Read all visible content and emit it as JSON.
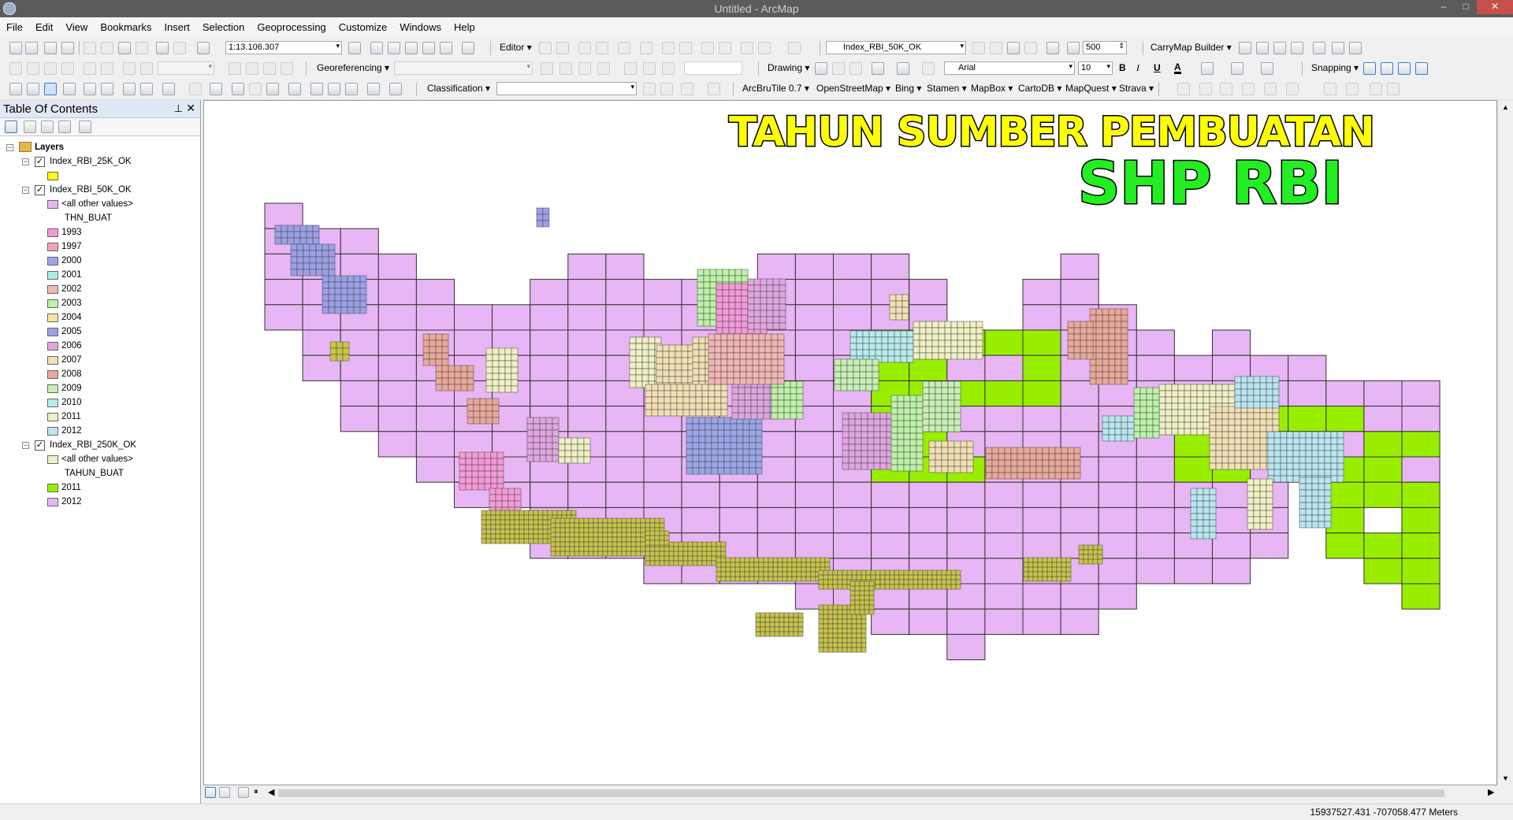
{
  "window": {
    "title": "Untitled - ArcMap",
    "minimize": "–",
    "maximize": "□",
    "close": "✕"
  },
  "menu": [
    "File",
    "Edit",
    "View",
    "Bookmarks",
    "Insert",
    "Selection",
    "Geoprocessing",
    "Customize",
    "Windows",
    "Help"
  ],
  "toolbar": {
    "scale": "1:13.106.307",
    "editor": "Editor",
    "target_layer": "Index_RBI_50K_OK",
    "zoom_value": "500",
    "carrymap": "CarryMap Builder",
    "georeferencing": "Georeferencing",
    "drawing": "Drawing",
    "font": "Arial",
    "font_size": "10",
    "bold": "B",
    "italic": "I",
    "underline": "U",
    "font_color": "A",
    "snapping": "Snapping",
    "classification": "Classification",
    "basemaps": [
      "ArcBruTile 0.7",
      "OpenStreetMap",
      "Bing",
      "Stamen",
      "MapBox",
      "CartoDB",
      "MapQuest",
      "Strava"
    ]
  },
  "toc": {
    "title": "Table Of Contents",
    "root": "Layers",
    "layer_25k": {
      "name": "Index_RBI_25K_OK",
      "color": "#ffff00"
    },
    "layer_50k": {
      "name": "Index_RBI_50K_OK",
      "other": "<all other values>",
      "field": "THN_BUAT",
      "classes": [
        {
          "label": "1993",
          "color": "#f49ad8"
        },
        {
          "label": "1997",
          "color": "#f4a6b6"
        },
        {
          "label": "2000",
          "color": "#9aa6e8"
        },
        {
          "label": "2001",
          "color": "#a6eee6"
        },
        {
          "label": "2002",
          "color": "#f2b6b6"
        },
        {
          "label": "2003",
          "color": "#bdf2a8"
        },
        {
          "label": "2004",
          "color": "#f6e89a"
        },
        {
          "label": "2005",
          "color": "#9ca0e8"
        },
        {
          "label": "2006",
          "color": "#e0a6e0"
        },
        {
          "label": "2007",
          "color": "#f2e0b4"
        },
        {
          "label": "2008",
          "color": "#eaa89a"
        },
        {
          "label": "2009",
          "color": "#c6f0b4"
        },
        {
          "label": "2010",
          "color": "#b6ecec"
        },
        {
          "label": "2011",
          "color": "#f0f0c4"
        },
        {
          "label": "2012",
          "color": "#b8e6f0"
        }
      ]
    },
    "layer_250k": {
      "name": "Index_RBI_250K_OK",
      "other": "<all other values>",
      "field": "TAHUN_BUAT",
      "classes": [
        {
          "label": "2011",
          "color": "#99ee00"
        },
        {
          "label": "2012",
          "color": "#e8b6f4"
        }
      ]
    }
  },
  "map": {
    "overlay_title_line1": "TAHUN SUMBER PEMBUATAN",
    "overlay_title_line2": "SHP RBI"
  },
  "status": {
    "coordinates": "15937527.431  -707058.477 Meters"
  }
}
